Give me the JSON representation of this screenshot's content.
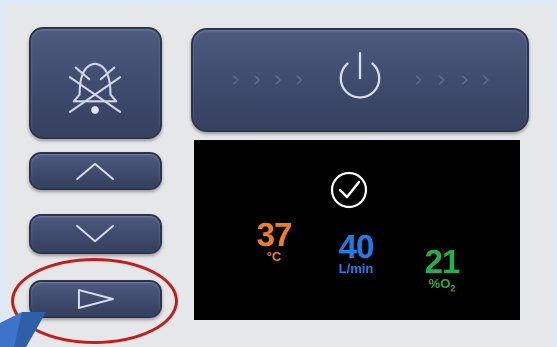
{
  "colors": {
    "button": "#3f4b6d",
    "screen_bg": "#000000",
    "temperature": "#f07f22",
    "flow": "#1e7de8",
    "oxygen": "#27ad4a",
    "highlight_ring": "#c71a1a",
    "pointer": "#3d74c9"
  },
  "controls": {
    "alarm_silence": {
      "icon": "bell-crossed-icon"
    },
    "power": {
      "icon": "power-icon"
    },
    "up": {
      "icon": "chevron-up-icon"
    },
    "down": {
      "icon": "chevron-down-icon"
    },
    "next": {
      "icon": "triangle-right-icon",
      "highlighted": true
    }
  },
  "display": {
    "status_icon": "check-circle-icon",
    "temperature": {
      "value": "37",
      "unit": "°C"
    },
    "flow": {
      "value": "40",
      "unit": "L/min"
    },
    "oxygen": {
      "value": "21",
      "unit": "%O",
      "unit_subscript": "2"
    }
  }
}
